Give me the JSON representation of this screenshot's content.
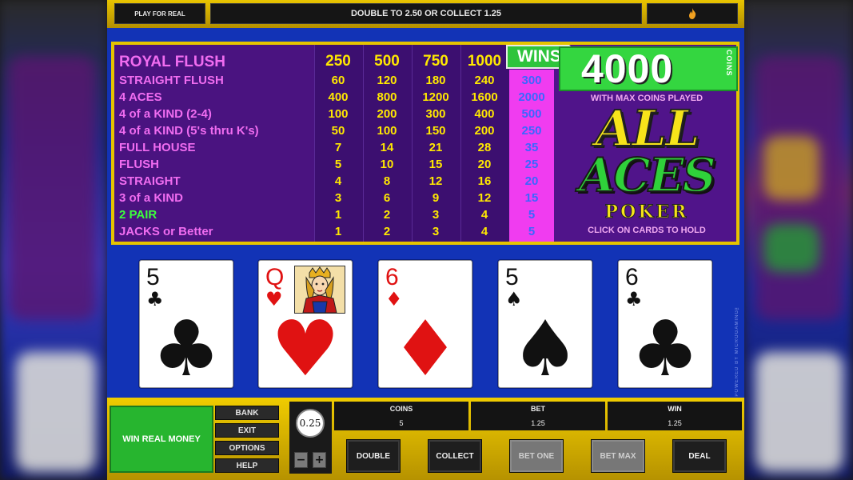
{
  "top_bar": {
    "play_for_real": "PLAY FOR REAL",
    "status_message": "DOUBLE TO 2.50 OR COLLECT 1.25",
    "flame_icon": "flame-icon"
  },
  "paytable": {
    "column_headers": [
      "250",
      "500",
      "750",
      "1000"
    ],
    "rows": [
      {
        "hand": "ROYAL FLUSH",
        "values": [
          "250",
          "500",
          "750",
          "1000"
        ],
        "highlight": ""
      },
      {
        "hand": "STRAIGHT FLUSH",
        "values": [
          "60",
          "120",
          "180",
          "240"
        ],
        "highlight": "300"
      },
      {
        "hand": "4 ACES",
        "values": [
          "400",
          "800",
          "1200",
          "1600"
        ],
        "highlight": "2000"
      },
      {
        "hand": "4 of a KIND (2-4)",
        "values": [
          "100",
          "200",
          "300",
          "400"
        ],
        "highlight": "500"
      },
      {
        "hand": "4 of a KIND (5's thru K's)",
        "values": [
          "50",
          "100",
          "150",
          "200"
        ],
        "highlight": "250"
      },
      {
        "hand": "FULL HOUSE",
        "values": [
          "7",
          "14",
          "21",
          "28"
        ],
        "highlight": "35"
      },
      {
        "hand": "FLUSH",
        "values": [
          "5",
          "10",
          "15",
          "20"
        ],
        "highlight": "25"
      },
      {
        "hand": "STRAIGHT",
        "values": [
          "4",
          "8",
          "12",
          "16"
        ],
        "highlight": "20"
      },
      {
        "hand": "3 of a KIND",
        "values": [
          "3",
          "6",
          "9",
          "12"
        ],
        "highlight": "15"
      },
      {
        "hand": "2 PAIR",
        "values": [
          "1",
          "2",
          "3",
          "4"
        ],
        "highlight": "5"
      },
      {
        "hand": "JACKS or Better",
        "values": [
          "1",
          "2",
          "3",
          "4"
        ],
        "highlight": "5"
      }
    ],
    "winning_row_color": "#3cff3c",
    "wins_label": "WINS",
    "wins_amount": "4000",
    "coins_label": "COINS",
    "max_coins_note": "WITH MAX COINS PLAYED",
    "logo_line1": "ALL",
    "logo_line2": "ACES",
    "logo_line3": "POKER",
    "hold_hint": "CLICK ON CARDS TO HOLD"
  },
  "cards": [
    {
      "rank": "5",
      "suit": "♣",
      "color": "black"
    },
    {
      "rank": "Q",
      "suit": "♥",
      "color": "red",
      "face": true
    },
    {
      "rank": "6",
      "suit": "♦",
      "color": "red"
    },
    {
      "rank": "5",
      "suit": "♠",
      "color": "black"
    },
    {
      "rank": "6",
      "suit": "♣",
      "color": "black"
    }
  ],
  "powered_by": "POWERED BY MICROGAMING™",
  "bottom": {
    "win_real_money": "WIN REAL MONEY",
    "side_buttons": [
      "BANK",
      "EXIT",
      "OPTIONS",
      "HELP"
    ],
    "coin_value": "0.25",
    "minus": "−",
    "plus": "+",
    "coins_label": "COINS",
    "coins_value": "5",
    "bet_label": "BET",
    "bet_value": "1.25",
    "win_label": "WIN",
    "win_value": "1.25",
    "actions": [
      {
        "label": "DOUBLE",
        "enabled": true
      },
      {
        "label": "COLLECT",
        "enabled": true
      },
      {
        "label": "BET ONE",
        "enabled": false
      },
      {
        "label": "BET MAX",
        "enabled": false
      },
      {
        "label": "DEAL",
        "enabled": true
      }
    ]
  },
  "colors": {
    "frame_gold": "#e6c400",
    "table_blue": "#1233b6",
    "paytable_purple": "#50148a",
    "highlight_magenta": "#f03cf0",
    "text_yellow": "#ffe800",
    "text_pink": "#f06cf0",
    "wins_green": "#34d640"
  }
}
